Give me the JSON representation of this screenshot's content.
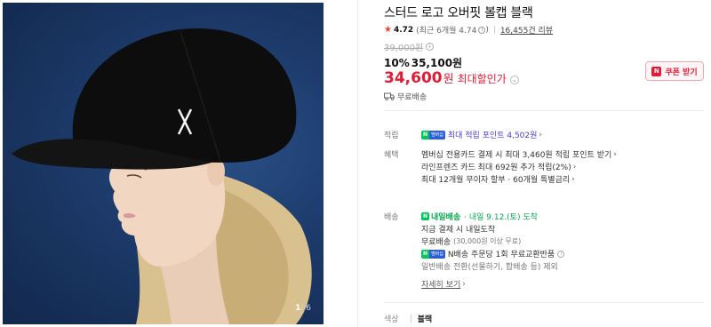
{
  "gallery": {
    "current": "1",
    "total": "/ 6"
  },
  "product": {
    "title": "스터드 로고 오버핏 볼캡 블랙",
    "rating": "4.72",
    "recent_rating": "(최근 6개월 4.74",
    "recent_close": ")",
    "reviews": "16,455건 리뷰",
    "original_price": "39,000원",
    "discount_pct": "10%",
    "discount_price": "35,100원",
    "final_price": "34,600",
    "final_won": "원",
    "final_label": "최대할인가",
    "coupon_label": "쿠폰 받기",
    "shipping": "무료배송"
  },
  "details": {
    "points_label": "적립",
    "points_text": "최대 적립 포인트 4,502원",
    "benefit_label": "혜택",
    "benefit_1": "멤버십 전용카드 결제 시 최대 3,460원 적립 포인트 받기",
    "benefit_2": "라인프렌즈 카드 최대 692원 추가 적립(2%)",
    "benefit_3": "최대 12개월 무이자 할부 · 60개월 특별금리",
    "delivery_label": "배송",
    "delivery_badge": "내일배송",
    "delivery_date": "· 내일 9.12.(토) 도착",
    "delivery_note": "지금 결제 시 내일도착",
    "delivery_free": "무료배송",
    "delivery_free_note": "(30,000원 이상 무료)",
    "npay_exchange": "N배송 주문당 1회 무료교환반품",
    "exclude_note": "일반배송 전환(선물하기, 합배송 등) 제외",
    "more_link": "자세히 보기",
    "color_label": "색상",
    "color_value": "블랙"
  },
  "colors": {
    "accent_red": "#e51a35",
    "naver_green": "#03c75a",
    "point_purple": "#4a3cd9",
    "background_blue": "#1c3a6a"
  }
}
